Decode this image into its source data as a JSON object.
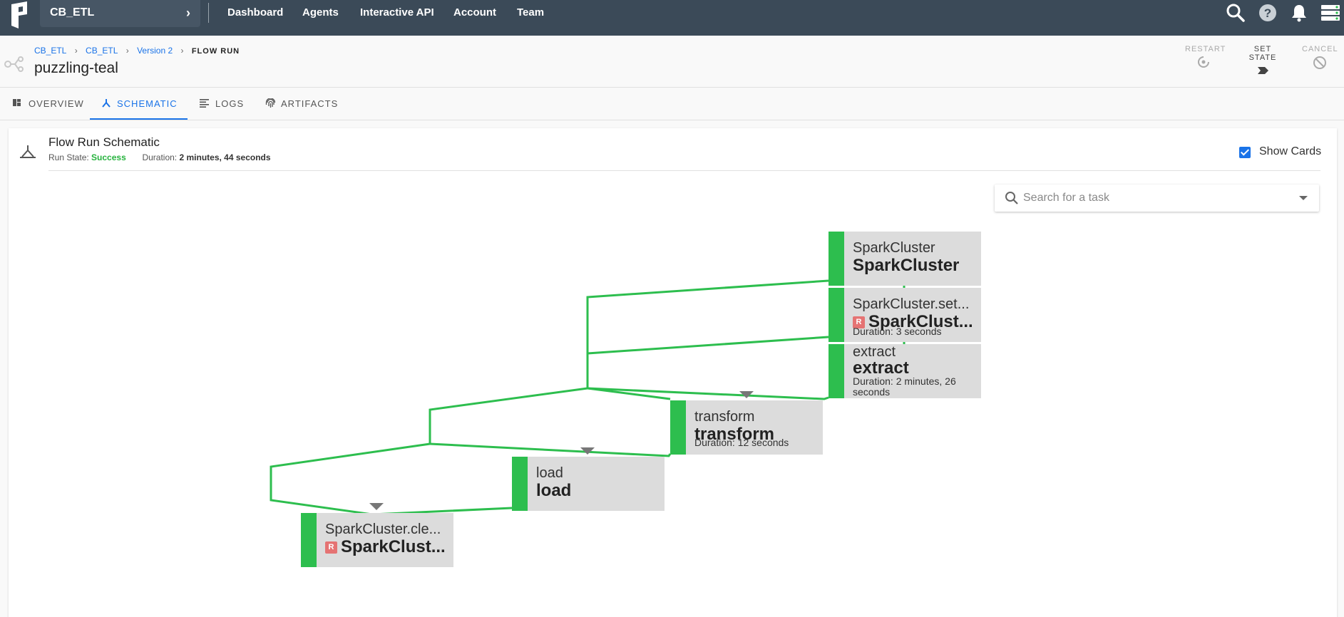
{
  "topbar": {
    "project": "CB_ETL",
    "nav": [
      "Dashboard",
      "Agents",
      "Interactive API",
      "Account",
      "Team"
    ]
  },
  "header": {
    "breadcrumbs": [
      "CB_ETL",
      "CB_ETL",
      "Version 2",
      "FLOW RUN"
    ],
    "run_name": "puzzling-teal",
    "actions": {
      "restart": "RESTART",
      "set_state": "SET STATE",
      "cancel": "CANCEL"
    }
  },
  "tabs": [
    "OVERVIEW",
    "SCHEMATIC",
    "LOGS",
    "ARTIFACTS"
  ],
  "schematic": {
    "title": "Flow Run Schematic",
    "run_state_label": "Run State:",
    "run_state": "Success",
    "duration_label": "Duration:",
    "duration": "2 minutes, 44 seconds",
    "show_cards_label": "Show Cards",
    "search_placeholder": "Search for a task",
    "nodes": [
      {
        "subtitle": "SparkCluster",
        "name": "SparkCluster",
        "duration": ""
      },
      {
        "subtitle": "SparkCluster.set...",
        "name": "SparkClust...",
        "badge": "R",
        "duration": "Duration: 3 seconds"
      },
      {
        "subtitle": "extract",
        "name": "extract",
        "duration": "Duration: 2 minutes, 26 seconds"
      },
      {
        "subtitle": "transform",
        "name": "transform",
        "duration": "Duration: 12 seconds"
      },
      {
        "subtitle": "load",
        "name": "load",
        "duration": ""
      },
      {
        "subtitle": "SparkCluster.cle...",
        "name": "SparkClust...",
        "badge": "R",
        "duration": ""
      }
    ]
  },
  "colors": {
    "topbar": "#3b4a58",
    "accent": "#1a73e8",
    "success": "#2dbe4e",
    "node_bg": "#dcdcdc",
    "retry_badge": "#e57373"
  }
}
